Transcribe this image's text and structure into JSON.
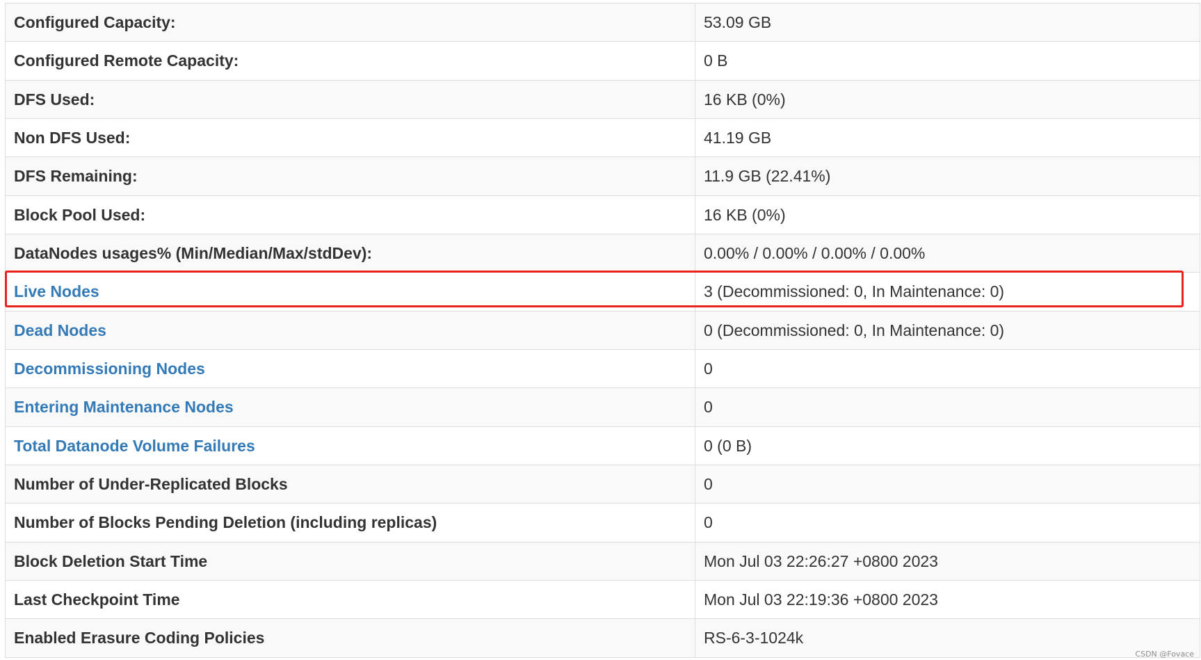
{
  "rows": [
    {
      "label": "Configured Capacity:",
      "value": "53.09 GB",
      "is_link": false
    },
    {
      "label": "Configured Remote Capacity:",
      "value": "0 B",
      "is_link": false
    },
    {
      "label": "DFS Used:",
      "value": "16 KB (0%)",
      "is_link": false
    },
    {
      "label": "Non DFS Used:",
      "value": "41.19 GB",
      "is_link": false
    },
    {
      "label": "DFS Remaining:",
      "value": "11.9 GB (22.41%)",
      "is_link": false
    },
    {
      "label": "Block Pool Used:",
      "value": "16 KB (0%)",
      "is_link": false
    },
    {
      "label": "DataNodes usages% (Min/Median/Max/stdDev):",
      "value": "0.00% / 0.00% / 0.00% / 0.00%",
      "is_link": false
    },
    {
      "label": "Live Nodes",
      "value": "3 (Decommissioned: 0, In Maintenance: 0)",
      "is_link": true
    },
    {
      "label": "Dead Nodes",
      "value": "0 (Decommissioned: 0, In Maintenance: 0)",
      "is_link": true
    },
    {
      "label": "Decommissioning Nodes",
      "value": "0",
      "is_link": true
    },
    {
      "label": "Entering Maintenance Nodes",
      "value": "0",
      "is_link": true
    },
    {
      "label": "Total Datanode Volume Failures",
      "value": "0 (0 B)",
      "is_link": true
    },
    {
      "label": "Number of Under-Replicated Blocks",
      "value": "0",
      "is_link": false
    },
    {
      "label": "Number of Blocks Pending Deletion (including replicas)",
      "value": "0",
      "is_link": false
    },
    {
      "label": "Block Deletion Start Time",
      "value": "Mon Jul 03 22:26:27 +0800 2023",
      "is_link": false
    },
    {
      "label": "Last Checkpoint Time",
      "value": "Mon Jul 03 22:19:36 +0800 2023",
      "is_link": false
    },
    {
      "label": "Enabled Erasure Coding Policies",
      "value": "RS-6-3-1024k",
      "is_link": false
    }
  ],
  "highlighted_row": "Live Nodes",
  "watermark": "CSDN @Fovace",
  "colors": {
    "link": "#337ab7",
    "highlight_border": "#e8231f",
    "row_stripe": "#f9f9f9",
    "border": "#dddddd"
  }
}
